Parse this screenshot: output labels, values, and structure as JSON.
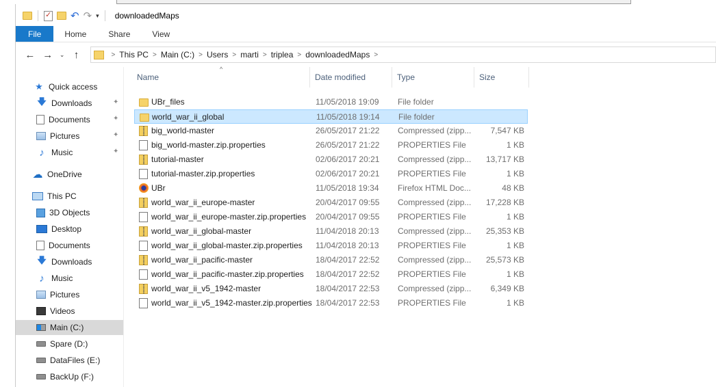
{
  "window": {
    "title": "downloadedMaps"
  },
  "ribbon": {
    "tabs": [
      "File",
      "Home",
      "Share",
      "View"
    ]
  },
  "address": {
    "crumbs": [
      "This PC",
      "Main (C:)",
      "Users",
      "marti",
      "triplea",
      "downloadedMaps"
    ]
  },
  "nav": {
    "quick_access": "Quick access",
    "qa_items": [
      "Downloads",
      "Documents",
      "Pictures",
      "Music"
    ],
    "onedrive": "OneDrive",
    "this_pc": "This PC",
    "pc_items": [
      "3D Objects",
      "Desktop",
      "Documents",
      "Downloads",
      "Music",
      "Pictures",
      "Videos"
    ],
    "drives": [
      "Main (C:)",
      "Spare (D:)",
      "DataFiles (E:)",
      "BackUp (F:)"
    ]
  },
  "columns": {
    "name": "Name",
    "date": "Date modified",
    "type": "Type",
    "size": "Size"
  },
  "files": [
    {
      "name": "UBr_files",
      "date": "11/05/2018 19:09",
      "type": "File folder",
      "size": "",
      "icon": "folder"
    },
    {
      "name": "world_war_ii_global",
      "date": "11/05/2018 19:14",
      "type": "File folder",
      "size": "",
      "icon": "folder",
      "selected": true
    },
    {
      "name": "big_world-master",
      "date": "26/05/2017 21:22",
      "type": "Compressed (zipp...",
      "size": "7,547 KB",
      "icon": "zip"
    },
    {
      "name": "big_world-master.zip.properties",
      "date": "26/05/2017 21:22",
      "type": "PROPERTIES File",
      "size": "1 KB",
      "icon": "doc"
    },
    {
      "name": "tutorial-master",
      "date": "02/06/2017 20:21",
      "type": "Compressed (zipp...",
      "size": "13,717 KB",
      "icon": "zip"
    },
    {
      "name": "tutorial-master.zip.properties",
      "date": "02/06/2017 20:21",
      "type": "PROPERTIES File",
      "size": "1 KB",
      "icon": "doc"
    },
    {
      "name": "UBr",
      "date": "11/05/2018 19:34",
      "type": "Firefox HTML Doc...",
      "size": "48 KB",
      "icon": "firefox"
    },
    {
      "name": "world_war_ii_europe-master",
      "date": "20/04/2017 09:55",
      "type": "Compressed (zipp...",
      "size": "17,228 KB",
      "icon": "zip"
    },
    {
      "name": "world_war_ii_europe-master.zip.properties",
      "date": "20/04/2017 09:55",
      "type": "PROPERTIES File",
      "size": "1 KB",
      "icon": "doc"
    },
    {
      "name": "world_war_ii_global-master",
      "date": "11/04/2018 20:13",
      "type": "Compressed (zipp...",
      "size": "25,353 KB",
      "icon": "zip"
    },
    {
      "name": "world_war_ii_global-master.zip.properties",
      "date": "11/04/2018 20:13",
      "type": "PROPERTIES File",
      "size": "1 KB",
      "icon": "doc"
    },
    {
      "name": "world_war_ii_pacific-master",
      "date": "18/04/2017 22:52",
      "type": "Compressed (zipp...",
      "size": "25,573 KB",
      "icon": "zip"
    },
    {
      "name": "world_war_ii_pacific-master.zip.properties",
      "date": "18/04/2017 22:52",
      "type": "PROPERTIES File",
      "size": "1 KB",
      "icon": "doc"
    },
    {
      "name": "world_war_ii_v5_1942-master",
      "date": "18/04/2017 22:53",
      "type": "Compressed (zipp...",
      "size": "6,349 KB",
      "icon": "zip"
    },
    {
      "name": "world_war_ii_v5_1942-master.zip.properties",
      "date": "18/04/2017 22:53",
      "type": "PROPERTIES File",
      "size": "1 KB",
      "icon": "doc"
    }
  ]
}
